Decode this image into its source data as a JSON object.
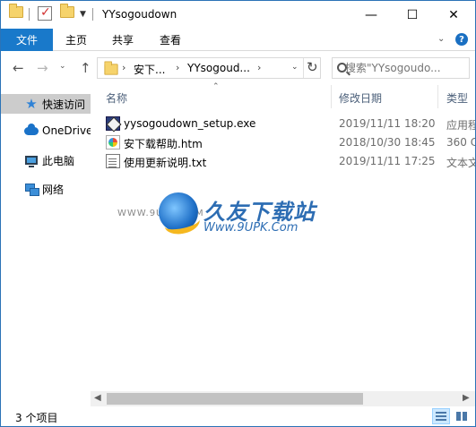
{
  "window": {
    "title": "YYsogoudown"
  },
  "ribbon": {
    "tabs": [
      {
        "label": "文件"
      },
      {
        "label": "主页"
      },
      {
        "label": "共享"
      },
      {
        "label": "查看"
      }
    ]
  },
  "address": {
    "crumbs": [
      "安下...",
      "YYsogoud..."
    ]
  },
  "search": {
    "placeholder": "搜索\"YYsogoudo..."
  },
  "nav": {
    "items": [
      {
        "label": "快速访问",
        "icon": "star-icon"
      },
      {
        "label": "OneDrive",
        "icon": "onedrive-icon"
      },
      {
        "label": "此电脑",
        "icon": "this-pc-icon"
      },
      {
        "label": "网络",
        "icon": "network-icon"
      }
    ]
  },
  "columns": {
    "name": "名称",
    "date": "修改日期",
    "type": "类型"
  },
  "files": [
    {
      "name": "yysogoudown_setup.exe",
      "date": "2019/11/11 18:20",
      "type": "应用程序",
      "icon": "exe-icon"
    },
    {
      "name": "安下载帮助.htm",
      "date": "2018/10/30 18:45",
      "type": "360 C",
      "icon": "htm-icon"
    },
    {
      "name": "使用更新说明.txt",
      "date": "2019/11/11 17:25",
      "type": "文本文",
      "icon": "txt-icon"
    }
  ],
  "watermark": {
    "cn": "久友下载站",
    "en": "Www.9UPK.Com",
    "side": "WWW.9UPK.COM"
  },
  "status": {
    "count": "3 个项目"
  }
}
